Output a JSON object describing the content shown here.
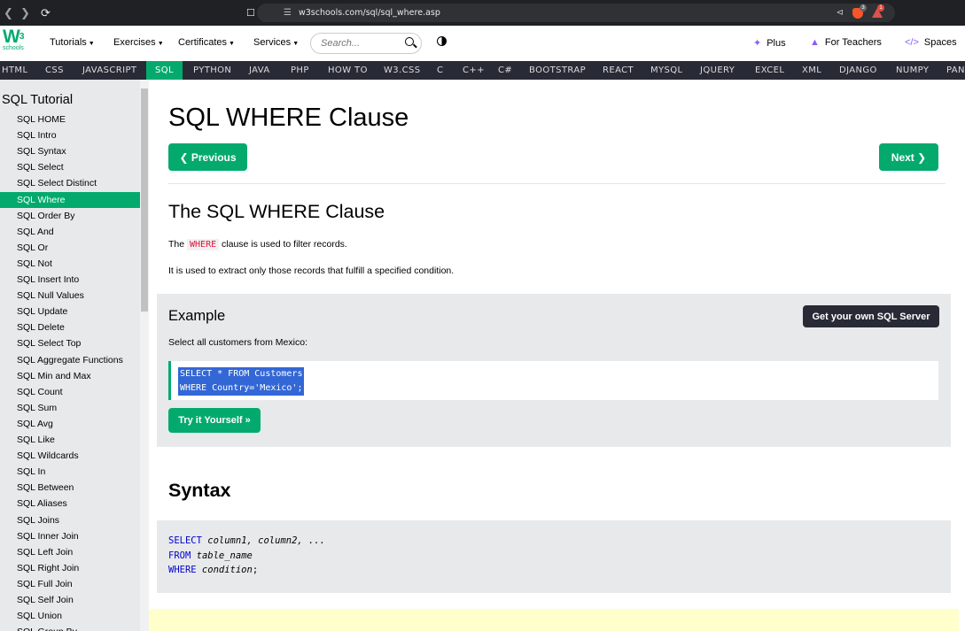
{
  "browser": {
    "url": "w3schools.com/sql/sql_where.asp",
    "brave_count": "3",
    "alert_count": "1"
  },
  "topnav": {
    "logo_main": "W",
    "logo_sup": "3",
    "logo_sub": "schools",
    "menu": [
      "Tutorials",
      "Exercises",
      "Certificates",
      "Services"
    ],
    "search_placeholder": "Search...",
    "plus": "Plus",
    "teachers": "For Teachers",
    "spaces": "Spaces"
  },
  "subnav": {
    "items": [
      "HTML",
      "CSS",
      "JAVASCRIPT",
      "SQL",
      "PYTHON",
      "JAVA",
      "PHP",
      "HOW TO",
      "W3.CSS",
      "C",
      "C++",
      "C#",
      "BOOTSTRAP",
      "REACT",
      "MYSQL",
      "JQUERY",
      "EXCEL",
      "XML",
      "DJANGO",
      "NUMPY",
      "PAN"
    ],
    "active": "SQL"
  },
  "sidebar": {
    "title": "SQL Tutorial",
    "items": [
      "SQL HOME",
      "SQL Intro",
      "SQL Syntax",
      "SQL Select",
      "SQL Select Distinct",
      "SQL Where",
      "SQL Order By",
      "SQL And",
      "SQL Or",
      "SQL Not",
      "SQL Insert Into",
      "SQL Null Values",
      "SQL Update",
      "SQL Delete",
      "SQL Select Top",
      "SQL Aggregate Functions",
      "SQL Min and Max",
      "SQL Count",
      "SQL Sum",
      "SQL Avg",
      "SQL Like",
      "SQL Wildcards",
      "SQL In",
      "SQL Between",
      "SQL Aliases",
      "SQL Joins",
      "SQL Inner Join",
      "SQL Left Join",
      "SQL Right Join",
      "SQL Full Join",
      "SQL Self Join",
      "SQL Union",
      "SQL Group By"
    ],
    "active": "SQL Where"
  },
  "main": {
    "title": "SQL WHERE Clause",
    "prev": "❮ Previous",
    "next": "Next ❯",
    "section_title": "The SQL WHERE Clause",
    "p1_before": "The ",
    "p1_code": "WHERE",
    "p1_after": " clause is used to filter records.",
    "p2": "It is used to extract only those records that fulfill a specified condition.",
    "example": {
      "title": "Example",
      "server_button": "Get your own SQL Server",
      "description": "Select all customers from Mexico:",
      "code_line1": "SELECT * FROM Customers",
      "code_line2": "WHERE Country='Mexico';",
      "try_button": "Try it Yourself »"
    },
    "syntax": {
      "title": "Syntax",
      "kw1": "SELECT",
      "rest1": " column1, column2, ...",
      "kw2": "FROM",
      "rest2": " table_name",
      "kw3": "WHERE",
      "rest3": " condition",
      "end3": ";"
    }
  }
}
